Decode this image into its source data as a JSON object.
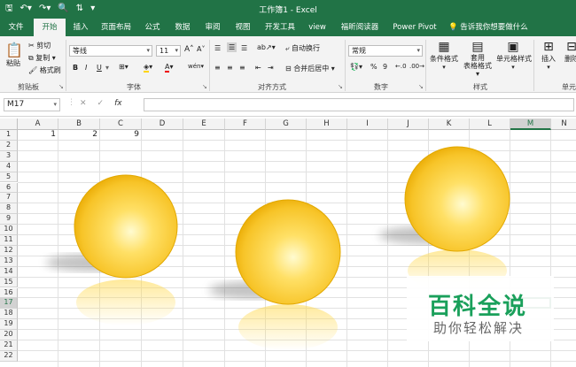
{
  "window": {
    "title": "工作簿1 - Excel",
    "quick_access": [
      "save-icon",
      "undo-icon",
      "redo-icon",
      "print-preview-icon",
      "sort-icon",
      "customize-icon"
    ]
  },
  "tabs": [
    {
      "label": "文件"
    },
    {
      "label": "开始"
    },
    {
      "label": "插入"
    },
    {
      "label": "页面布局"
    },
    {
      "label": "公式"
    },
    {
      "label": "数据"
    },
    {
      "label": "审阅"
    },
    {
      "label": "视图"
    },
    {
      "label": "开发工具"
    },
    {
      "label": "view"
    },
    {
      "label": "福昕阅读器"
    },
    {
      "label": "Power Pivot"
    }
  ],
  "active_tab": "开始",
  "tell_me": "告诉我你想要做什么",
  "ribbon": {
    "clipboard": {
      "paste": "粘贴",
      "cut": "剪切",
      "copy": "复制",
      "format_painter": "格式刷",
      "group": "剪贴板"
    },
    "font": {
      "name": "等线",
      "size": "11",
      "group": "字体",
      "bold": "B",
      "italic": "I",
      "underline": "U",
      "grow": "A",
      "shrink": "A",
      "wen": "wén"
    },
    "alignment": {
      "wrap": "自动换行",
      "merge": "合并后居中",
      "group": "对齐方式"
    },
    "number": {
      "format": "常规",
      "percent": "%",
      "comma": "9",
      "group": "数字"
    },
    "styles": {
      "conditional": "条件格式",
      "table": "套用\n表格格式",
      "cell": "单元格样式",
      "group": "样式"
    },
    "cells": {
      "insert": "插入",
      "delete": "删除",
      "group": "单元"
    }
  },
  "formula_bar": {
    "name_box": "M17",
    "fx": "fx",
    "value": ""
  },
  "columns": [
    "A",
    "B",
    "C",
    "D",
    "E",
    "F",
    "G",
    "H",
    "I",
    "J",
    "K",
    "L",
    "M",
    "N"
  ],
  "rows": [
    "1",
    "2",
    "3",
    "4",
    "5",
    "6",
    "7",
    "8",
    "9",
    "10",
    "11",
    "12",
    "13",
    "14",
    "15",
    "16",
    "17",
    "18",
    "19",
    "20",
    "21",
    "22"
  ],
  "selected_cell": "M17",
  "cells": [
    {
      "ref": "A1",
      "value": "1"
    },
    {
      "ref": "B1",
      "value": "2"
    },
    {
      "ref": "C1",
      "value": "9"
    }
  ],
  "colors": {
    "accent": "#217346",
    "sphere": "#f5b800",
    "sphere_light": "#fff3a0"
  },
  "watermark": {
    "title": "百科全说",
    "subtitle": "助你轻松解决"
  }
}
